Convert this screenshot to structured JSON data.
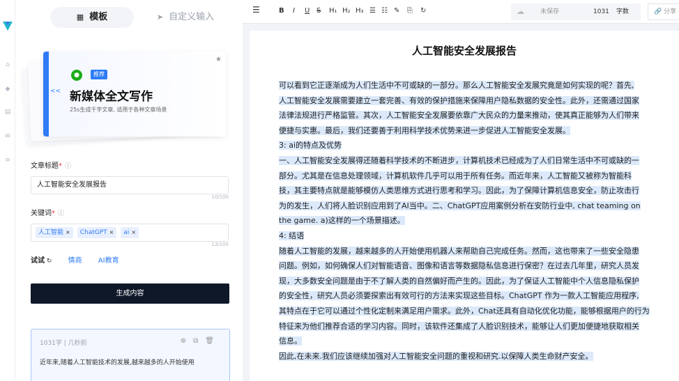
{
  "rail": {
    "icons": [
      "logo-icon",
      "home-icon",
      "tag-icon",
      "document-icon",
      "mail-icon",
      "database-icon"
    ]
  },
  "tabs": {
    "template": "模板",
    "custom_input": "自定义输入"
  },
  "card": {
    "tag": "推荐",
    "title": "新媒体全文写作",
    "subtitle": "25s生成千字文章, 适用于各种文章场景"
  },
  "form": {
    "title_label": "文章标题",
    "title_value": "人工智能安全发展报告",
    "title_count": "10/100",
    "keywords_label": "关键词",
    "keywords": [
      "人工智能",
      "ChatGPT",
      "ai"
    ],
    "keywords_count": "13/100",
    "try_label": "试试",
    "try_links": [
      "情商",
      "AI教育"
    ],
    "generate_button": "生成内容"
  },
  "preview": {
    "meta": "1031字 | 几秒前",
    "text": "近年来,随着人工智能技术的发展,越来越多的人开始使用"
  },
  "toolbar": {
    "buttons": [
      "B",
      "I",
      "U",
      "S",
      "H₁",
      "H₂",
      "H₃",
      "☰",
      "☷",
      "✎",
      "⎘",
      "↻"
    ],
    "save_status": "未保存",
    "word_count": "1031",
    "word_count_label": "字数",
    "share": "分享"
  },
  "document": {
    "title": "人工智能安全发展报告",
    "lines": [
      "可以看到它正逐渐成为人们生活中不可或缺的一部分。那么人工智能安全发展究竟是如何实现的呢？首先,",
      "人工智能安全发展需要建立一套完善、有效的保护措施来保障用户隐私数据的安全性。此外，还需通过国家",
      "法律法规进行严格监管。其次，人工智能安全发展要依靠广大民众的力量来推动，使其真正能够为人们带来",
      "便捷与实惠。最后，我们还要善于利用科学技术优势来进一步促进人工智能安全发展。",
      "3: ai的特点及优势",
      "一、人工智能安全发展得还随着科学技术的不断进步，计算机技术已经成为了人们日常生活中不可或缺的一",
      "部分。尤其是在信息处理领域，计算机软件几乎可以用于所有任务。而近年来，人工智能又被称为智能科",
      "技，其主要特点就是能够模仿人类思维方式进行思考和学习。因此，为了保障计算机信息安全，防止攻击行",
      "为的发生，人们将人脸识别应用到了AI当中。二、ChatGPT应用案例分析在安防行业中, chat teaming on",
      "the game. a)这样的一个场景描述。",
      "4: 结语",
      "随着人工智能的发展，越来越多的人开始使用机器人来帮助自己完成任务。然而，这也带来了一些安全隐患",
      "问题。例如，如何确保人们对智能语音、图像和语言等数据隐私信息进行保密？在过去几年里，研究人员发",
      "现，大多数安全问题是由于不了解人类的自然偏好而产生的。因此，为了保证人工智能中个人信息隐私保护",
      "的安全性，研究人员必须要探索出有效可行的方法来实现这些目标。ChatGPT 作为一款人工智能应用程序,",
      "其特点在于它可以通过个性化定制来满足用户需求。此外，Chat还具有自动化优化功能，能够根据用户的行为",
      "特征来为他们推荐合适的学习内容。同时，该软件还集成了人脸识别技术，能够让人们更加便捷地获取相关",
      "信息。",
      "因此,在未来.我们应该继续加强对人工智能安全问题的重视和研究.以保障人类生命财产安全。"
    ]
  }
}
